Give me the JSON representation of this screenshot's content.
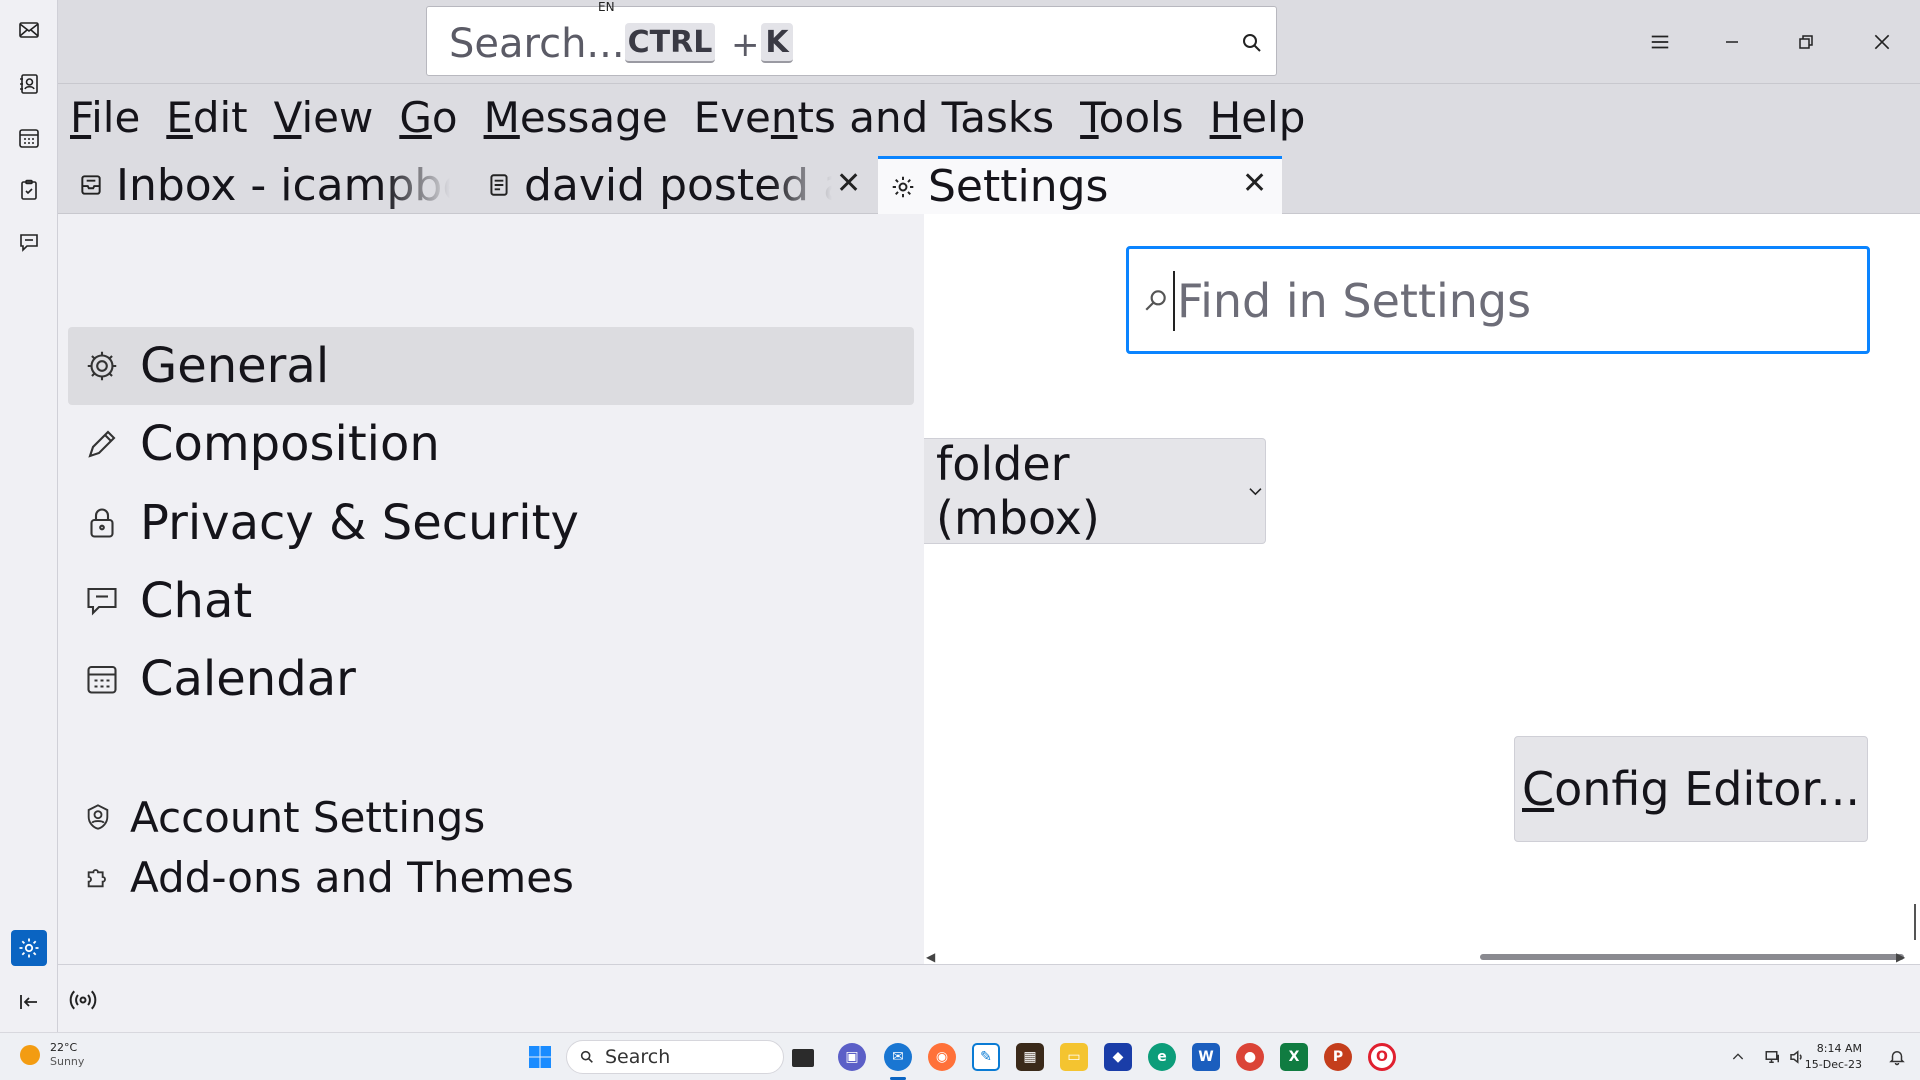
{
  "spaces": {
    "items": [
      "mail-icon",
      "address-book-icon",
      "calendar-icon",
      "tasks-icon",
      "chat-icon"
    ],
    "settings": "gear-icon",
    "collapse": "collapse-left-icon"
  },
  "titlebar": {
    "search_placeholder": "Search...",
    "shortcut_key1": "CTRL",
    "shortcut_plus": "+",
    "shortcut_key2": "K",
    "language": "EN"
  },
  "menu": [
    {
      "pre": "",
      "ul": "F",
      "post": "ile"
    },
    {
      "pre": "",
      "ul": "E",
      "post": "dit"
    },
    {
      "pre": "",
      "ul": "V",
      "post": "iew"
    },
    {
      "pre": "",
      "ul": "G",
      "post": "o"
    },
    {
      "pre": "",
      "ul": "M",
      "post": "essage"
    },
    {
      "pre": "Eve",
      "ul": "n",
      "post": "ts and Tasks"
    },
    {
      "pre": "",
      "ul": "T",
      "post": "ools"
    },
    {
      "pre": "",
      "ul": "H",
      "post": "elp"
    }
  ],
  "tabs": {
    "inbox": "Inbox - icampbell@",
    "message": "david posted an",
    "settings": "Settings",
    "close_glyph": "✕"
  },
  "sidebar": {
    "categories": [
      {
        "label": "General",
        "icon": "gear-icon",
        "selected": true
      },
      {
        "label": "Composition",
        "icon": "pencil-icon",
        "selected": false
      },
      {
        "label": "Privacy & Security",
        "icon": "lock-icon",
        "selected": false
      },
      {
        "label": "Chat",
        "icon": "chat-icon",
        "selected": false
      },
      {
        "label": "Calendar",
        "icon": "calendar-icon",
        "selected": false
      }
    ],
    "footer": [
      {
        "label": "Account Settings",
        "icon": "account-icon"
      },
      {
        "label": "Add-ons and Themes",
        "icon": "puzzle-icon"
      }
    ]
  },
  "content": {
    "find_placeholder": "Find in Settings",
    "dropdown_value": "folder (mbox)",
    "config_editor": {
      "ul": "C",
      "post": "onfig Editor..."
    }
  },
  "taskbar": {
    "weather_temp": "22°C",
    "weather_desc": "Sunny",
    "search_label": "Search",
    "time": "8:14 AM",
    "date": "15-Dec-23"
  },
  "colors": {
    "accent": "#0a84ff",
    "active_space": "#0a64c2"
  }
}
